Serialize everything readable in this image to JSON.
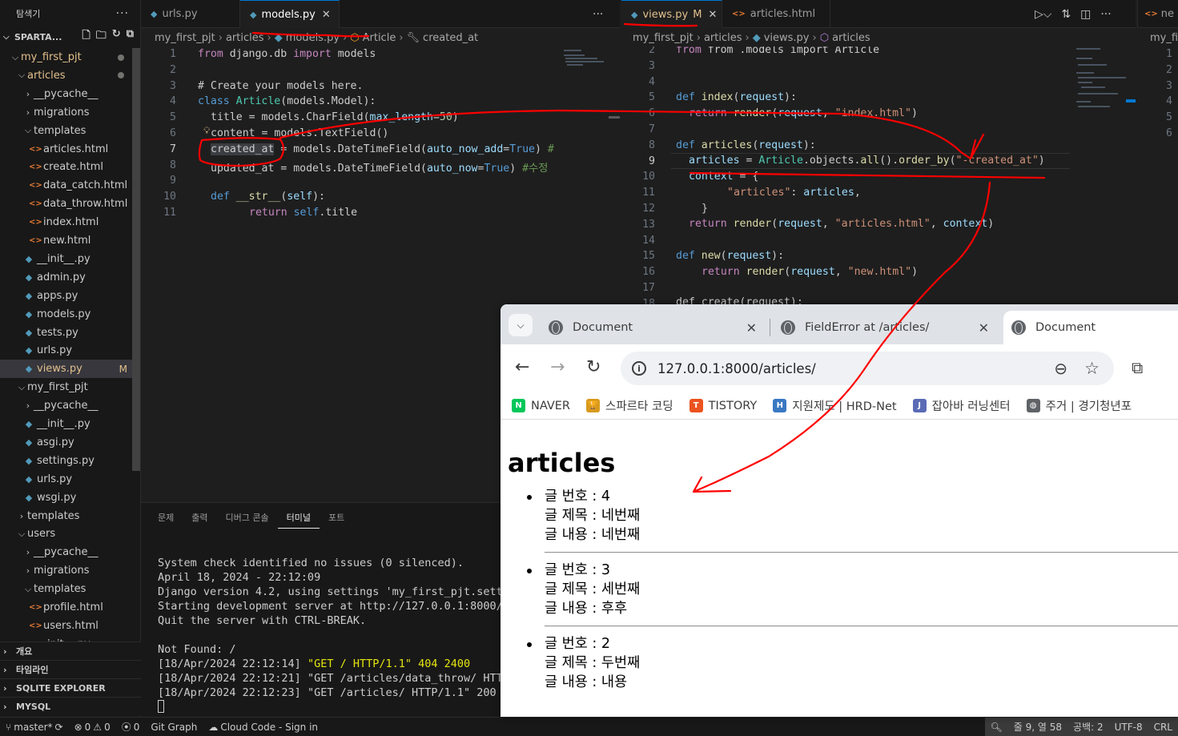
{
  "explorer": {
    "title": "탐색기",
    "root": "SPARTA...",
    "tree": [
      {
        "label": "my_first_pjt",
        "kind": "folder-open",
        "depth": 1,
        "dot": true,
        "yellow": true
      },
      {
        "label": "articles",
        "kind": "folder-open",
        "depth": 2,
        "dot": true,
        "yellow": true
      },
      {
        "label": "__pycache__",
        "kind": "folder",
        "depth": 3
      },
      {
        "label": "migrations",
        "kind": "folder",
        "depth": 3
      },
      {
        "label": "templates",
        "kind": "folder-open",
        "depth": 3
      },
      {
        "label": "articles.html",
        "kind": "html",
        "depth": 4
      },
      {
        "label": "create.html",
        "kind": "html",
        "depth": 4
      },
      {
        "label": "data_catch.html",
        "kind": "html",
        "depth": 4
      },
      {
        "label": "data_throw.html",
        "kind": "html",
        "depth": 4
      },
      {
        "label": "index.html",
        "kind": "html",
        "depth": 4
      },
      {
        "label": "new.html",
        "kind": "html",
        "depth": 4
      },
      {
        "label": "__init__.py",
        "kind": "py",
        "depth": 3
      },
      {
        "label": "admin.py",
        "kind": "py",
        "depth": 3
      },
      {
        "label": "apps.py",
        "kind": "py",
        "depth": 3
      },
      {
        "label": "models.py",
        "kind": "py",
        "depth": 3
      },
      {
        "label": "tests.py",
        "kind": "py",
        "depth": 3
      },
      {
        "label": "urls.py",
        "kind": "py",
        "depth": 3
      },
      {
        "label": "views.py",
        "kind": "py",
        "depth": 3,
        "selected": true,
        "badge": "M",
        "yellow": true
      },
      {
        "label": "my_first_pjt",
        "kind": "folder-open",
        "depth": 2
      },
      {
        "label": "__pycache__",
        "kind": "folder",
        "depth": 3
      },
      {
        "label": "__init__.py",
        "kind": "py",
        "depth": 3
      },
      {
        "label": "asgi.py",
        "kind": "py",
        "depth": 3
      },
      {
        "label": "settings.py",
        "kind": "py",
        "depth": 3
      },
      {
        "label": "urls.py",
        "kind": "py",
        "depth": 3
      },
      {
        "label": "wsgi.py",
        "kind": "py",
        "depth": 3
      },
      {
        "label": "templates",
        "kind": "folder",
        "depth": 2
      },
      {
        "label": "users",
        "kind": "folder-open",
        "depth": 2
      },
      {
        "label": "__pycache__",
        "kind": "folder",
        "depth": 3
      },
      {
        "label": "migrations",
        "kind": "folder",
        "depth": 3
      },
      {
        "label": "templates",
        "kind": "folder-open",
        "depth": 3
      },
      {
        "label": "profile.html",
        "kind": "html",
        "depth": 4
      },
      {
        "label": "users.html",
        "kind": "html",
        "depth": 4
      },
      {
        "label": "__init__.py",
        "kind": "py",
        "depth": 3
      }
    ],
    "sections": [
      "개요",
      "타임라인",
      "SQLITE EXPLORER",
      "MYSQL"
    ]
  },
  "editor_left": {
    "tabs": [
      {
        "label": "urls.py",
        "icon": "py",
        "active": false
      },
      {
        "label": "models.py",
        "icon": "py",
        "active": true,
        "close": "✕"
      }
    ],
    "breadcrumb": [
      "my_first_pjt",
      "articles",
      "models.py",
      "Article",
      "created_at"
    ],
    "line_numbers": [
      "1",
      "2",
      "3",
      "4",
      "5",
      "6",
      "7",
      "8",
      "9",
      "10",
      "11"
    ],
    "current_line": "7",
    "code": {
      "l1_from": "from",
      "l1_mod": "django.db",
      "l1_import": "import",
      "l1_name": "models",
      "l3": "# Create your models here.",
      "l4_kw": "class",
      "l4_cls": "Article",
      "l4_base": "models.Model",
      "l5_name": "title",
      "l5_call": "models.CharField",
      "l5_kw": "max_length",
      "l5_num": "50",
      "l6_name": "content",
      "l6_call": "models.TextField",
      "l7_name": "created_at",
      "l7_call": "models.DateTimeField",
      "l7_kw": "auto_now_add",
      "l7_val": "True",
      "l7_cm": "#",
      "l8_name": "updated_at",
      "l8_call": "models.DateTimeField",
      "l8_kw": "auto_now",
      "l8_val": "True",
      "l8_cm": "#수정",
      "l10_kw": "def",
      "l10_fn": "__str__",
      "l10_p": "self",
      "l11_kw": "return",
      "l11_p": "self",
      "l11_attr": "title"
    }
  },
  "editor_right": {
    "tabs": [
      {
        "label": "views.py",
        "icon": "py",
        "active": true,
        "mod": "M",
        "close": "✕"
      },
      {
        "label": "articles.html",
        "icon": "html",
        "active": false
      }
    ],
    "breadcrumb": [
      "my_first_pjt",
      "articles",
      "views.py",
      "articles"
    ],
    "line_numbers": [
      "2",
      "3",
      "4",
      "5",
      "6",
      "7",
      "8",
      "9",
      "10",
      "11",
      "12",
      "13",
      "14",
      "15",
      "16",
      "17",
      "18"
    ],
    "current_line": "9",
    "code": {
      "l2": "from .models import Article",
      "l5_kw": "def",
      "l5_fn": "index",
      "l5_p": "request",
      "l6_kw": "return",
      "l6_fn": "render",
      "l6_p": "request",
      "l6_s": "\"index.html\"",
      "l8_kw": "def",
      "l8_fn": "articles",
      "l8_p": "request",
      "l9_var": "articles",
      "l9_obj": "Article",
      "l9_rest": ".objects.",
      "l9_fn1": "all",
      "l9_fn2": "order_by",
      "l9_s": "\"-created_at\"",
      "l10_var": "context",
      "l11_s": "\"articles\"",
      "l11_v": "articles",
      "l13_kw": "return",
      "l13_fn": "render",
      "l13_p": "request",
      "l13_s": "\"articles.html\"",
      "l13_v": "context",
      "l15_kw": "def",
      "l15_fn": "new",
      "l15_p": "request",
      "l16_kw": "return",
      "l16_fn": "render",
      "l16_p": "request",
      "l16_s": "\"new.html\"",
      "l18": "def create(request):"
    }
  },
  "editor_third": {
    "tab": "ne",
    "breadcrumb": "my_fir",
    "line_numbers": [
      "1",
      "2",
      "3",
      "4",
      "5",
      "6"
    ]
  },
  "panel": {
    "tabs": [
      "문제",
      "출력",
      "디버그 콘솔",
      "터미널",
      "포트"
    ],
    "active_tab": "터미널",
    "terminal_lines": [
      "System check identified no issues (0 silenced).",
      "April 18, 2024 - 22:12:09",
      "Django version 4.2, using settings 'my_first_pjt.setti",
      "Starting development server at http://127.0.0.1:8000/",
      "Quit the server with CTRL-BREAK.",
      "",
      "Not Found: /"
    ],
    "log_lines": [
      {
        "ts": "[18/Apr/2024 22:12:14]",
        "req": "\"GET / HTTP/1.1\" 404 2400",
        "yellow": true
      },
      {
        "ts": "[18/Apr/2024 22:12:21]",
        "req": "\"GET /articles/data_throw/ HTTP",
        "yellow": false
      },
      {
        "ts": "[18/Apr/2024 22:12:23]",
        "req": "\"GET /articles/ HTTP/1.1\" 200 7",
        "yellow": false
      }
    ]
  },
  "statusbar": {
    "branch": "master*",
    "errors": "0",
    "warnings": "0",
    "ports": "0",
    "git_graph": "Git Graph",
    "cloud_code": "Cloud Code - Sign in",
    "position": "줄 9, 열 58",
    "spaces": "공백: 2",
    "encoding": "UTF-8",
    "eol": "CRL"
  },
  "browser": {
    "tabs": [
      {
        "title": "Document",
        "active": false
      },
      {
        "title": "FieldError at /articles/",
        "active": false
      },
      {
        "title": "Document",
        "active": true
      }
    ],
    "url": "127.0.0.1:8000/articles/",
    "bookmarks": [
      {
        "label": "NAVER",
        "icon": "N",
        "color": "#03c75a"
      },
      {
        "label": "스파르타 코딩",
        "icon": "🏆",
        "color": "#d99a1e"
      },
      {
        "label": "TISTORY",
        "icon": "T",
        "color": "#eb531f"
      },
      {
        "label": "지원제도 | HRD-Net",
        "icon": "H",
        "color": "#3a78c2"
      },
      {
        "label": "잡아바 러닝센터",
        "icon": "J",
        "color": "#5b6bb5"
      },
      {
        "label": "주거 | 경기청년포",
        "icon": "◍",
        "color": "#5f6368"
      }
    ],
    "page": {
      "heading": "articles",
      "articles": [
        {
          "no_label": "글 번호 : 4",
          "title_label": "글 제목 : 네번째",
          "content_label": "글 내용 : 네번째"
        },
        {
          "no_label": "글 번호 : 3",
          "title_label": "글 제목 : 세번째",
          "content_label": "글 내용 : 후후"
        },
        {
          "no_label": "글 번호 : 2",
          "title_label": "글 제목 : 두번째",
          "content_label": "글 내용 : 내용"
        }
      ]
    }
  },
  "colors": {
    "accent": "#0078d4",
    "annotation": "#ff0000",
    "modified": "#e2c08d"
  }
}
